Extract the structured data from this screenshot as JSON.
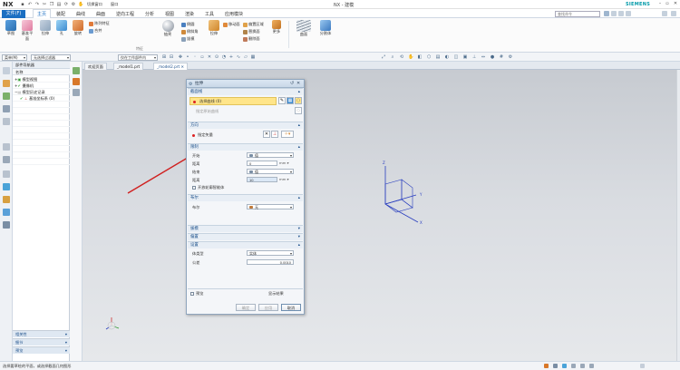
{
  "titlebar": {
    "logo": "NX",
    "title": "NX - 建模",
    "brand": "SIEMENS",
    "switch_window": "切换窗口",
    "window_menu": "窗口"
  },
  "menu": {
    "file": "文件(F)",
    "tabs": [
      "主页",
      "装配",
      "曲线",
      "曲面",
      "逆向工程",
      "分析",
      "视图",
      "渲染",
      "工具",
      "应用模块"
    ],
    "active_tab": "主页",
    "search_placeholder": "查找命令"
  },
  "ribbon": {
    "direct_sketch": {
      "label": "草图"
    },
    "datum_plane": {
      "label": "基准平面"
    },
    "feature_small": [
      "拉伸",
      "孔",
      "旋转"
    ],
    "more_small": [
      "阵列特征",
      "合并"
    ],
    "sphere": {
      "label": "抽壳"
    },
    "edge_col": [
      "倒圆",
      "倒斜角",
      "拔模"
    ],
    "sync_col1": [
      "拉伸",
      "移动面"
    ],
    "sync_col2": [
      "偏置区域",
      "替换面",
      "删除面"
    ],
    "more": {
      "label": "更多"
    },
    "surface": {
      "label": "曲面"
    },
    "split_body": {
      "label": "分割体"
    },
    "group_label": "特征"
  },
  "selbar": {
    "menu": "菜单(M)",
    "filter": "无选择过滤器",
    "scope": "仅在工作部件内"
  },
  "navigator": {
    "title": "部件导航器",
    "column": "名称",
    "rows": [
      {
        "label": "模型视图",
        "indent": 2
      },
      {
        "label": "摄像机",
        "indent": 2
      },
      {
        "label": "模型历史记录",
        "indent": 2
      },
      {
        "label": "基准坐标系 (0)",
        "indent": 8
      }
    ],
    "panels": [
      "相关性",
      "细节",
      "预览"
    ]
  },
  "doctabs": [
    "欢迎页面",
    "_model1.prt",
    "_model2.prt"
  ],
  "dialog": {
    "title": "拉伸",
    "section_profile": "截面线",
    "select_curve": "选择曲线 (0)",
    "specify_origin_curve": "指定原始曲线",
    "section_direction": "方向",
    "specify_vector": "指定矢量",
    "section_limits": "限制",
    "start_label": "开始",
    "start_value": "值",
    "distance_label": "距离",
    "start_distance": "0",
    "end_label": "结束",
    "end_value": "值",
    "end_distance": "10",
    "unit": "mm",
    "open_profile": "开放轮廓智能体",
    "section_boolean": "布尔",
    "boolean_label": "布尔",
    "boolean_value": "无",
    "section_draft": "拔模",
    "section_offset": "偏置",
    "section_settings": "设置",
    "body_type_label": "体类型",
    "body_type_value": "实体",
    "tolerance_label": "公差",
    "tolerance_value": "0.0010",
    "preview": "预览",
    "show_result": "显示结果",
    "ok": "确定",
    "apply": "应用",
    "cancel": "取消"
  },
  "status": {
    "message": "选择要草绘的平面，或选择截面几何图形"
  },
  "colors": {
    "accent": "#1b6fc2",
    "highlight": "#ffe58a",
    "arrow": "#d0201f",
    "axes": "#2a3fbf"
  }
}
